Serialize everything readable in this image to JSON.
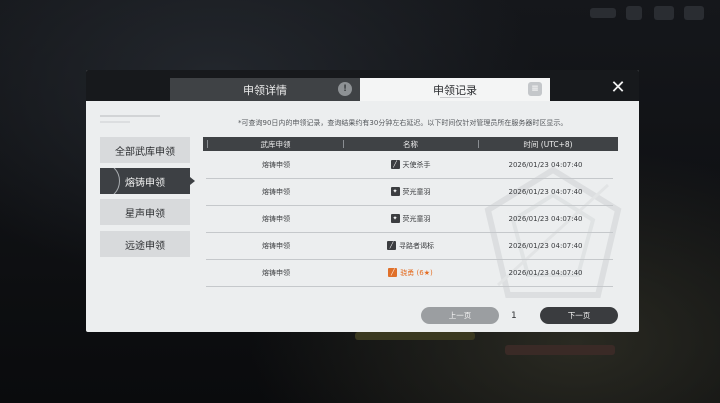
{
  "tabs": {
    "details_label": "申领详情",
    "records_label": "申领记录"
  },
  "close_icon": "close-icon",
  "note": "*可查询90日内的申领记录，查询结果约有30分钟左右延迟。以下时间仅针对管理员所在服务器时区显示。",
  "sidebar": {
    "items": [
      {
        "label": "全部武库申领",
        "active": false
      },
      {
        "label": "熔铸申领",
        "active": true
      },
      {
        "label": "星声申领",
        "active": false
      },
      {
        "label": "远途申领",
        "active": false
      }
    ]
  },
  "table": {
    "headers": [
      "武库申领",
      "名称",
      "时间 (UTC+8)"
    ],
    "rows": [
      {
        "type": "熔铸申领",
        "name": "天使杀手",
        "time": "2026/01/23 04:07:40",
        "icon": "sword-icon",
        "highlight": false
      },
      {
        "type": "熔铸申领",
        "name": "荧光童羽",
        "time": "2026/01/23 04:07:40",
        "icon": "gear-icon",
        "highlight": false
      },
      {
        "type": "熔铸申领",
        "name": "荧光童羽",
        "time": "2026/01/23 04:07:40",
        "icon": "gear-icon",
        "highlight": false
      },
      {
        "type": "熔铸申领",
        "name": "寻路者谒标",
        "time": "2026/01/23 04:07:40",
        "icon": "sword-icon",
        "highlight": false
      },
      {
        "type": "熔铸申领",
        "name": "骁勇 (6★)",
        "time": "2026/01/23 04:07:40",
        "icon": "sword-icon",
        "highlight": true
      }
    ]
  },
  "pagination": {
    "prev_label": "上一页",
    "page": "1",
    "next_label": "下一页"
  },
  "colors": {
    "accent_orange": "#e46d22",
    "dark_panel": "#3f4245",
    "dialog_bg": "#eceeef"
  }
}
